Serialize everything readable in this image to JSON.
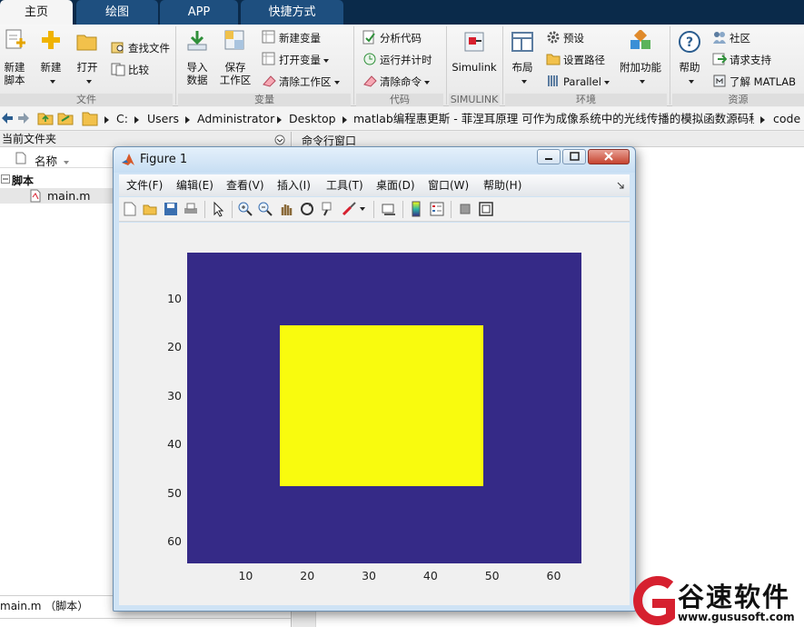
{
  "tabs": [
    {
      "label": "主页",
      "active": true
    },
    {
      "label": "绘图",
      "active": false
    },
    {
      "label": "APP",
      "active": false
    },
    {
      "label": "快捷方式",
      "active": false
    }
  ],
  "ribbon": {
    "file": {
      "new_script": [
        "新建",
        "脚本"
      ],
      "new": "新建",
      "open": "打开",
      "find_files": "查找文件",
      "compare": "比较",
      "group": "文件"
    },
    "variable": {
      "import": [
        "导入",
        "数据"
      ],
      "save": [
        "保存",
        "工作区"
      ],
      "new_variable": "新建变量",
      "open_variable": "打开变量",
      "clear_workspace": "清除工作区",
      "group": "变量"
    },
    "code": {
      "analyze": "分析代码",
      "run_time": "运行并计时",
      "clear_commands": "清除命令",
      "group": "代码"
    },
    "simulink": {
      "label": "Simulink",
      "group": "SIMULINK"
    },
    "environment": {
      "layout": "布局",
      "preferences": "预设",
      "set_path": "设置路径",
      "parallel": "Parallel",
      "addons": "附加功能",
      "group": "环境"
    },
    "resources": {
      "help": "帮助",
      "community": "社区",
      "request_support": "请求支持",
      "learn": "了解 MATLAB",
      "group": "资源"
    }
  },
  "address": {
    "crumbs": [
      "C:",
      "Users",
      "Administrator",
      "Desktop",
      "matlab编程惠更斯 - 菲涅耳原理 可作为成像系统中的光线传播的模拟函数源码程序",
      "code"
    ]
  },
  "file_browser": {
    "title": "当前文件夹",
    "column_name": "名称",
    "section": "脚本",
    "files": [
      "main.m"
    ],
    "details": "main.m （脚本）"
  },
  "command_window": {
    "title": "命令行窗口"
  },
  "figure": {
    "title": "Figure 1",
    "menus": [
      "文件(F)",
      "编辑(E)",
      "查看(V)",
      "插入(I)",
      "工具(T)",
      "桌面(D)",
      "窗口(W)",
      "帮助(H)"
    ]
  },
  "chart_data": {
    "type": "heatmap",
    "description_free": true,
    "xlim": [
      0.5,
      64.5
    ],
    "ylim": [
      0.5,
      64.5
    ],
    "y_reversed": true,
    "xticks": [
      10,
      20,
      30,
      40,
      50,
      60
    ],
    "yticks": [
      10,
      20,
      30,
      40,
      50,
      60
    ],
    "background_value": 0,
    "background_color": "#352a87",
    "blocks": [
      {
        "x_range": [
          16,
          48
        ],
        "y_range": [
          16,
          48
        ],
        "value": 1,
        "color": "#f9fb0e"
      }
    ]
  },
  "watermark": {
    "brand": "谷速软件",
    "url": "www.gususoft.com"
  },
  "colors": {
    "tab_bar": "#0a2a4a",
    "tab_inactive": "#1e4f7f",
    "accent_red": "#d6202f"
  }
}
